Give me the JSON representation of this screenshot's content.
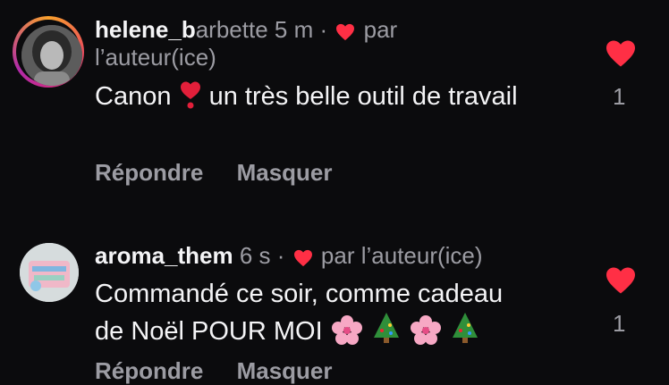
{
  "comments": [
    {
      "username": "helene_b",
      "username_faded": "arbette",
      "time": "5 m",
      "separator": "·",
      "by_author_label": "par",
      "by_author_label_2": "l’auteur(ice)",
      "text_before_emoji": "Canon",
      "emoji": "heavy-heart-exclamation",
      "text_after_emoji": "un très belle outil de travail",
      "actions": [
        "Répondre",
        "Masquer"
      ],
      "likes": "1",
      "liked": true
    },
    {
      "username": "aroma_them",
      "time": "6 s",
      "separator": "·",
      "by_author_label": "par l’auteur(ice)",
      "text_line1": "Commandé ce soir, comme cadeau",
      "text_line2": "de Noël POUR MOI",
      "emojis": [
        "cherry-blossom",
        "christmas-tree",
        "cherry-blossom",
        "christmas-tree"
      ],
      "actions": [
        "Répondre",
        "Masquer"
      ],
      "likes": "1",
      "liked": true
    }
  ],
  "colors": {
    "background": "#0b0b0d",
    "text_primary": "#f4f4f6",
    "text_secondary": "#9c9ca3",
    "heart": "#ff2f45"
  }
}
